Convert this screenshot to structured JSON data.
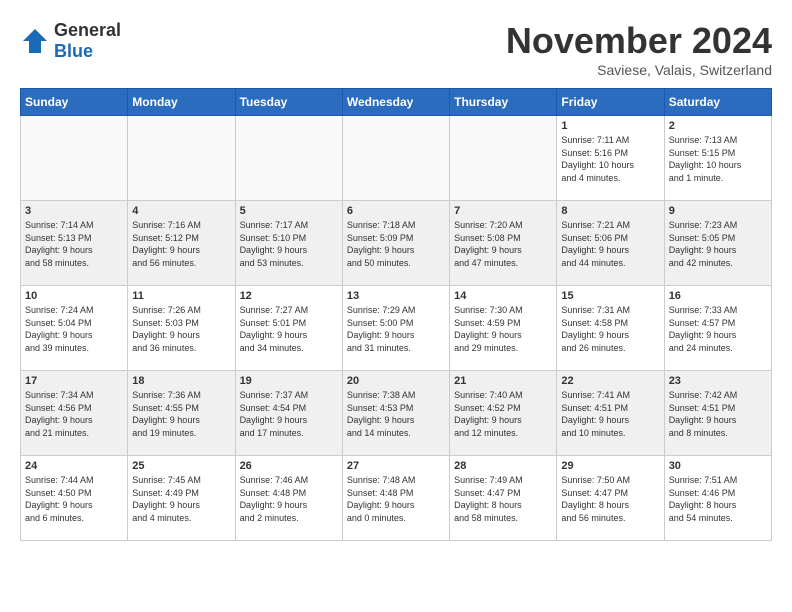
{
  "logo": {
    "general": "General",
    "blue": "Blue"
  },
  "header": {
    "month": "November 2024",
    "location": "Saviese, Valais, Switzerland"
  },
  "weekdays": [
    "Sunday",
    "Monday",
    "Tuesday",
    "Wednesday",
    "Thursday",
    "Friday",
    "Saturday"
  ],
  "weeks": [
    [
      {
        "day": "",
        "info": ""
      },
      {
        "day": "",
        "info": ""
      },
      {
        "day": "",
        "info": ""
      },
      {
        "day": "",
        "info": ""
      },
      {
        "day": "",
        "info": ""
      },
      {
        "day": "1",
        "info": "Sunrise: 7:11 AM\nSunset: 5:16 PM\nDaylight: 10 hours\nand 4 minutes."
      },
      {
        "day": "2",
        "info": "Sunrise: 7:13 AM\nSunset: 5:15 PM\nDaylight: 10 hours\nand 1 minute."
      }
    ],
    [
      {
        "day": "3",
        "info": "Sunrise: 7:14 AM\nSunset: 5:13 PM\nDaylight: 9 hours\nand 58 minutes."
      },
      {
        "day": "4",
        "info": "Sunrise: 7:16 AM\nSunset: 5:12 PM\nDaylight: 9 hours\nand 56 minutes."
      },
      {
        "day": "5",
        "info": "Sunrise: 7:17 AM\nSunset: 5:10 PM\nDaylight: 9 hours\nand 53 minutes."
      },
      {
        "day": "6",
        "info": "Sunrise: 7:18 AM\nSunset: 5:09 PM\nDaylight: 9 hours\nand 50 minutes."
      },
      {
        "day": "7",
        "info": "Sunrise: 7:20 AM\nSunset: 5:08 PM\nDaylight: 9 hours\nand 47 minutes."
      },
      {
        "day": "8",
        "info": "Sunrise: 7:21 AM\nSunset: 5:06 PM\nDaylight: 9 hours\nand 44 minutes."
      },
      {
        "day": "9",
        "info": "Sunrise: 7:23 AM\nSunset: 5:05 PM\nDaylight: 9 hours\nand 42 minutes."
      }
    ],
    [
      {
        "day": "10",
        "info": "Sunrise: 7:24 AM\nSunset: 5:04 PM\nDaylight: 9 hours\nand 39 minutes."
      },
      {
        "day": "11",
        "info": "Sunrise: 7:26 AM\nSunset: 5:03 PM\nDaylight: 9 hours\nand 36 minutes."
      },
      {
        "day": "12",
        "info": "Sunrise: 7:27 AM\nSunset: 5:01 PM\nDaylight: 9 hours\nand 34 minutes."
      },
      {
        "day": "13",
        "info": "Sunrise: 7:29 AM\nSunset: 5:00 PM\nDaylight: 9 hours\nand 31 minutes."
      },
      {
        "day": "14",
        "info": "Sunrise: 7:30 AM\nSunset: 4:59 PM\nDaylight: 9 hours\nand 29 minutes."
      },
      {
        "day": "15",
        "info": "Sunrise: 7:31 AM\nSunset: 4:58 PM\nDaylight: 9 hours\nand 26 minutes."
      },
      {
        "day": "16",
        "info": "Sunrise: 7:33 AM\nSunset: 4:57 PM\nDaylight: 9 hours\nand 24 minutes."
      }
    ],
    [
      {
        "day": "17",
        "info": "Sunrise: 7:34 AM\nSunset: 4:56 PM\nDaylight: 9 hours\nand 21 minutes."
      },
      {
        "day": "18",
        "info": "Sunrise: 7:36 AM\nSunset: 4:55 PM\nDaylight: 9 hours\nand 19 minutes."
      },
      {
        "day": "19",
        "info": "Sunrise: 7:37 AM\nSunset: 4:54 PM\nDaylight: 9 hours\nand 17 minutes."
      },
      {
        "day": "20",
        "info": "Sunrise: 7:38 AM\nSunset: 4:53 PM\nDaylight: 9 hours\nand 14 minutes."
      },
      {
        "day": "21",
        "info": "Sunrise: 7:40 AM\nSunset: 4:52 PM\nDaylight: 9 hours\nand 12 minutes."
      },
      {
        "day": "22",
        "info": "Sunrise: 7:41 AM\nSunset: 4:51 PM\nDaylight: 9 hours\nand 10 minutes."
      },
      {
        "day": "23",
        "info": "Sunrise: 7:42 AM\nSunset: 4:51 PM\nDaylight: 9 hours\nand 8 minutes."
      }
    ],
    [
      {
        "day": "24",
        "info": "Sunrise: 7:44 AM\nSunset: 4:50 PM\nDaylight: 9 hours\nand 6 minutes."
      },
      {
        "day": "25",
        "info": "Sunrise: 7:45 AM\nSunset: 4:49 PM\nDaylight: 9 hours\nand 4 minutes."
      },
      {
        "day": "26",
        "info": "Sunrise: 7:46 AM\nSunset: 4:48 PM\nDaylight: 9 hours\nand 2 minutes."
      },
      {
        "day": "27",
        "info": "Sunrise: 7:48 AM\nSunset: 4:48 PM\nDaylight: 9 hours\nand 0 minutes."
      },
      {
        "day": "28",
        "info": "Sunrise: 7:49 AM\nSunset: 4:47 PM\nDaylight: 8 hours\nand 58 minutes."
      },
      {
        "day": "29",
        "info": "Sunrise: 7:50 AM\nSunset: 4:47 PM\nDaylight: 8 hours\nand 56 minutes."
      },
      {
        "day": "30",
        "info": "Sunrise: 7:51 AM\nSunset: 4:46 PM\nDaylight: 8 hours\nand 54 minutes."
      }
    ]
  ]
}
